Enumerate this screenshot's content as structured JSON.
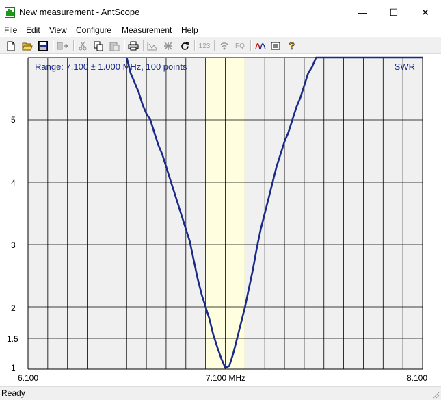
{
  "window": {
    "title": "New measurement - AntScope",
    "minimize_glyph": "—",
    "maximize_glyph": "☐",
    "close_glyph": "✕"
  },
  "menu": [
    "File",
    "Edit",
    "View",
    "Configure",
    "Measurement",
    "Help"
  ],
  "toolbar": {
    "icons": [
      "new-file-icon",
      "open-folder-icon",
      "save-icon",
      "export-icon",
      "cut-icon",
      "copy-icon",
      "paste-icon",
      "print-icon",
      "graph-icon",
      "marker-icon",
      "refresh-icon",
      "numeric-123-icon",
      "antenna-icon",
      "fq-icon",
      "swr-curve-icon",
      "list-icon",
      "help-icon"
    ],
    "label_123": "123",
    "label_fq": "FQ"
  },
  "chart_data": {
    "type": "line",
    "range_label": "Range: 7.100 ± 1.000 MHz, 100 points",
    "series_label": "SWR",
    "x_tick_labels": [
      "6.100",
      "7.100 MHz",
      "8.100"
    ],
    "y_tick_labels": [
      "1",
      "1.5",
      "2",
      "3",
      "4",
      "5"
    ],
    "xlim": [
      6.1,
      8.1
    ],
    "ylim": [
      1,
      6
    ],
    "y_scale": "custom (1, 1.5, 2, 3, 4, 5, 6 equally spaced above 2; 1–2 split at 1.5)",
    "highlight_band_mhz": [
      7.0,
      7.2
    ],
    "highlight_color": "#ffffe0",
    "line_color": "#1a2a8a",
    "series": [
      {
        "x": [
          6.6,
          6.62,
          6.64,
          6.66,
          6.68,
          6.7,
          6.72,
          6.74,
          6.76,
          6.78,
          6.8,
          6.82,
          6.84,
          6.86,
          6.88,
          6.9,
          6.92,
          6.94,
          6.96,
          6.98,
          7.0,
          7.02,
          7.04,
          7.06,
          7.08,
          7.1,
          7.12,
          7.14,
          7.16,
          7.18,
          7.2,
          7.22,
          7.24,
          7.26,
          7.28,
          7.3,
          7.32,
          7.34,
          7.36,
          7.38,
          7.4,
          7.42,
          7.44,
          7.46,
          7.48,
          7.5,
          7.52,
          7.54,
          7.56,
          7.58,
          7.6,
          7.62,
          7.64,
          7.66,
          7.68,
          7.7,
          8.1
        ],
        "y": [
          6.0,
          5.75,
          5.6,
          5.45,
          5.25,
          5.1,
          5.0,
          4.8,
          4.6,
          4.45,
          4.25,
          4.05,
          3.85,
          3.65,
          3.45,
          3.25,
          3.05,
          2.75,
          2.45,
          2.2,
          2.0,
          1.8,
          1.55,
          1.35,
          1.17,
          1.02,
          1.05,
          1.25,
          1.5,
          1.75,
          2.0,
          2.3,
          2.6,
          2.95,
          3.25,
          3.5,
          3.75,
          4.0,
          4.25,
          4.45,
          4.65,
          4.8,
          5.0,
          5.2,
          5.35,
          5.55,
          5.75,
          5.85,
          6.0,
          6.0,
          6.0,
          6.0,
          6.0,
          6.0,
          6.0,
          6.0,
          6.0
        ]
      }
    ]
  },
  "status": "Ready"
}
